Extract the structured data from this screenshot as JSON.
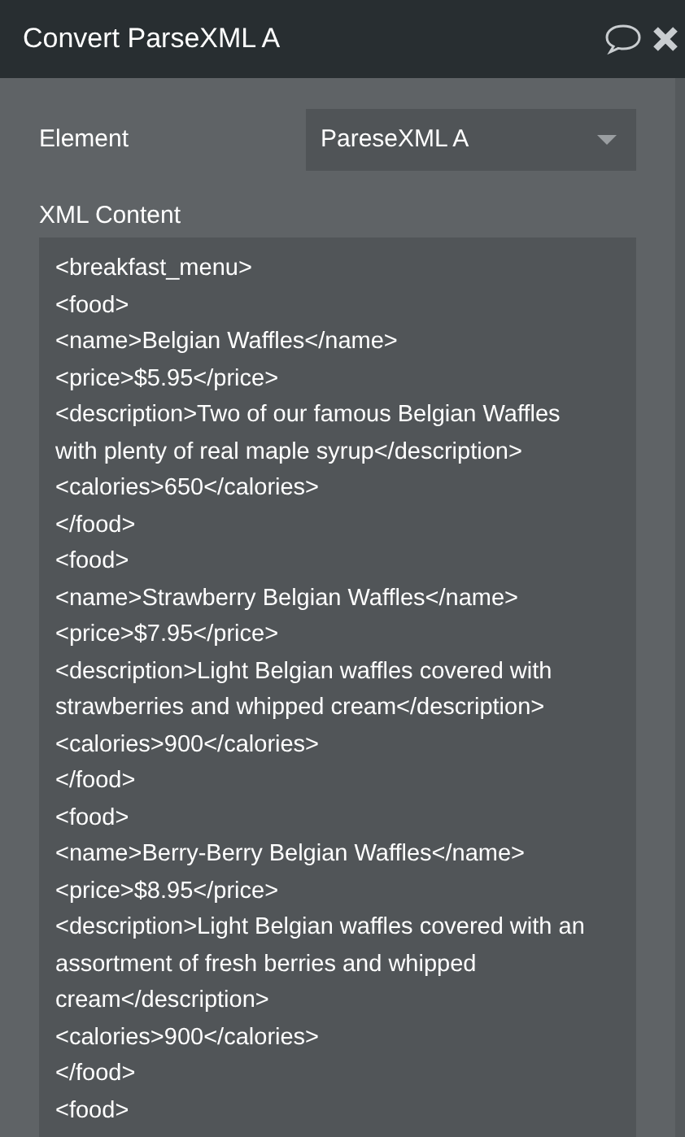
{
  "window": {
    "title": "Convert ParseXML A"
  },
  "fields": [
    {
      "label": "Element",
      "value": "PareseXML A"
    }
  ],
  "xml_content": {
    "label": "XML Content",
    "lines": [
      "<breakfast_menu>",
      "<food>",
      "<name>Belgian Waffles</name>",
      "<price>$5.95</price>",
      "<description>Two of our famous Belgian Waffles",
      "with plenty of real maple syrup</description>",
      "<calories>650</calories>",
      "</food>",
      "<food>",
      "<name>Strawberry Belgian Waffles</name>",
      "<price>$7.95</price>",
      "<description>Light Belgian waffles covered with",
      "strawberries and whipped cream</description>",
      "<calories>900</calories>",
      "</food>",
      "<food>",
      "<name>Berry-Berry Belgian Waffles</name>",
      "<price>$8.95</price>",
      "<description>Light Belgian waffles covered with an",
      "assortment of fresh berries and whipped",
      "cream</description>",
      "<calories>900</calories>",
      "</food>",
      "<food>"
    ]
  }
}
